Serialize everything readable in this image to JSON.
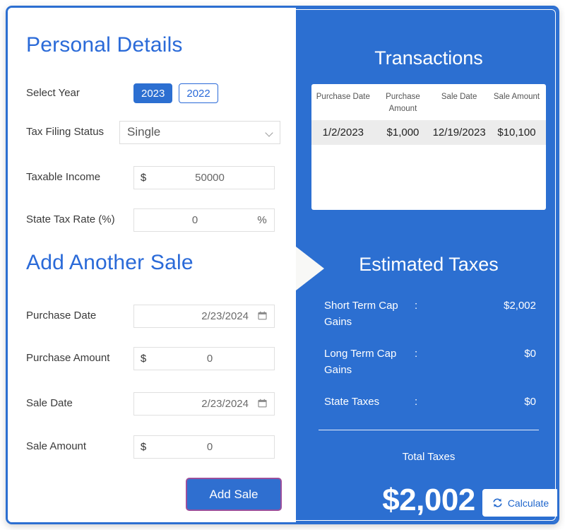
{
  "left": {
    "personal_details": {
      "title": "Personal Details",
      "select_year": {
        "label": "Select Year",
        "options": [
          "2023",
          "2022"
        ],
        "selected": "2023"
      },
      "filing_status": {
        "label": "Tax Filing Status",
        "value": "Single",
        "chevron_icon": "chevron-down-icon"
      },
      "taxable_income": {
        "label": "Taxable Income",
        "prefix": "$",
        "value": "50000"
      },
      "state_tax_rate": {
        "label": "State Tax Rate (%)",
        "suffix": "%",
        "value": "0"
      }
    },
    "add_another_sale": {
      "title": "Add Another Sale",
      "purchase_date": {
        "label": "Purchase Date",
        "value": "2/23/2024",
        "icon": "calendar-icon"
      },
      "purchase_amount": {
        "label": "Purchase Amount",
        "prefix": "$",
        "value": "0"
      },
      "sale_date": {
        "label": "Sale Date",
        "value": "2/23/2024",
        "icon": "calendar-icon"
      },
      "sale_amount": {
        "label": "Sale Amount",
        "prefix": "$",
        "value": "0"
      },
      "add_sale_button": "Add Sale"
    }
  },
  "right": {
    "transactions": {
      "title": "Transactions",
      "columns": [
        "Purchase Date",
        "Purchase Amount",
        "Sale Date",
        "Sale Amount"
      ],
      "rows": [
        {
          "purchase_date": "1/2/2023",
          "purchase_amount": "$1,000",
          "sale_date": "12/19/2023",
          "sale_amount": "$10,100"
        }
      ]
    },
    "estimated_taxes": {
      "title": "Estimated Taxes",
      "items": [
        {
          "name": "Short Term Cap Gains",
          "separator": ":",
          "amount": "$2,002"
        },
        {
          "name": "Long Term Cap Gains",
          "separator": ":",
          "amount": "$0"
        },
        {
          "name": "State Taxes",
          "separator": ":",
          "amount": "$0"
        }
      ],
      "total_label": "Total Taxes",
      "total_value": "$2,002"
    },
    "calculate_button": {
      "label": "Calculate",
      "icon": "sync-refresh-icon"
    }
  },
  "colors": {
    "brand_blue": "#2c6fd1",
    "title_blue": "#2a6ad8",
    "add_sale_border": "#9b4f9b",
    "panel_white": "#ffffff",
    "table_row_bg": "#ececec"
  }
}
